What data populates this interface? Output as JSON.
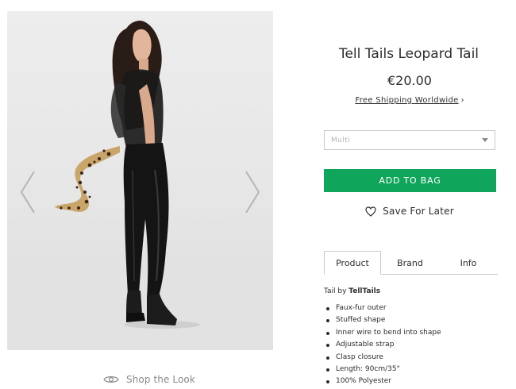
{
  "product": {
    "title": "Tell Tails Leopard Tail",
    "price": "€20.00",
    "shipping_link": "Free Shipping Worldwide",
    "shipping_chevron": "›"
  },
  "gallery": {
    "prev_icon": "chevron-left-icon",
    "next_icon": "chevron-right-icon",
    "shop_look_label": "Shop the Look",
    "shop_look_icon": "eye-icon"
  },
  "variant_select": {
    "selected": "Multi",
    "icon": "caret-down-icon"
  },
  "actions": {
    "add_to_bag_label": "ADD TO BAG",
    "save_for_later_label": "Save For Later",
    "save_icon": "heart-icon",
    "accent_color": "#0fa55a"
  },
  "tabs": [
    {
      "label": "Product",
      "active": true
    },
    {
      "label": "Brand",
      "active": false
    },
    {
      "label": "Info",
      "active": false
    }
  ],
  "description": {
    "intro_prefix": "Tail by ",
    "brand": "TellTails",
    "bullets": [
      "Faux-fur outer",
      "Stuffed shape",
      "Inner wire to bend into shape",
      "Adjustable strap",
      "Clasp closure",
      "Length: 90cm/35\"",
      "100% Polyester"
    ]
  }
}
